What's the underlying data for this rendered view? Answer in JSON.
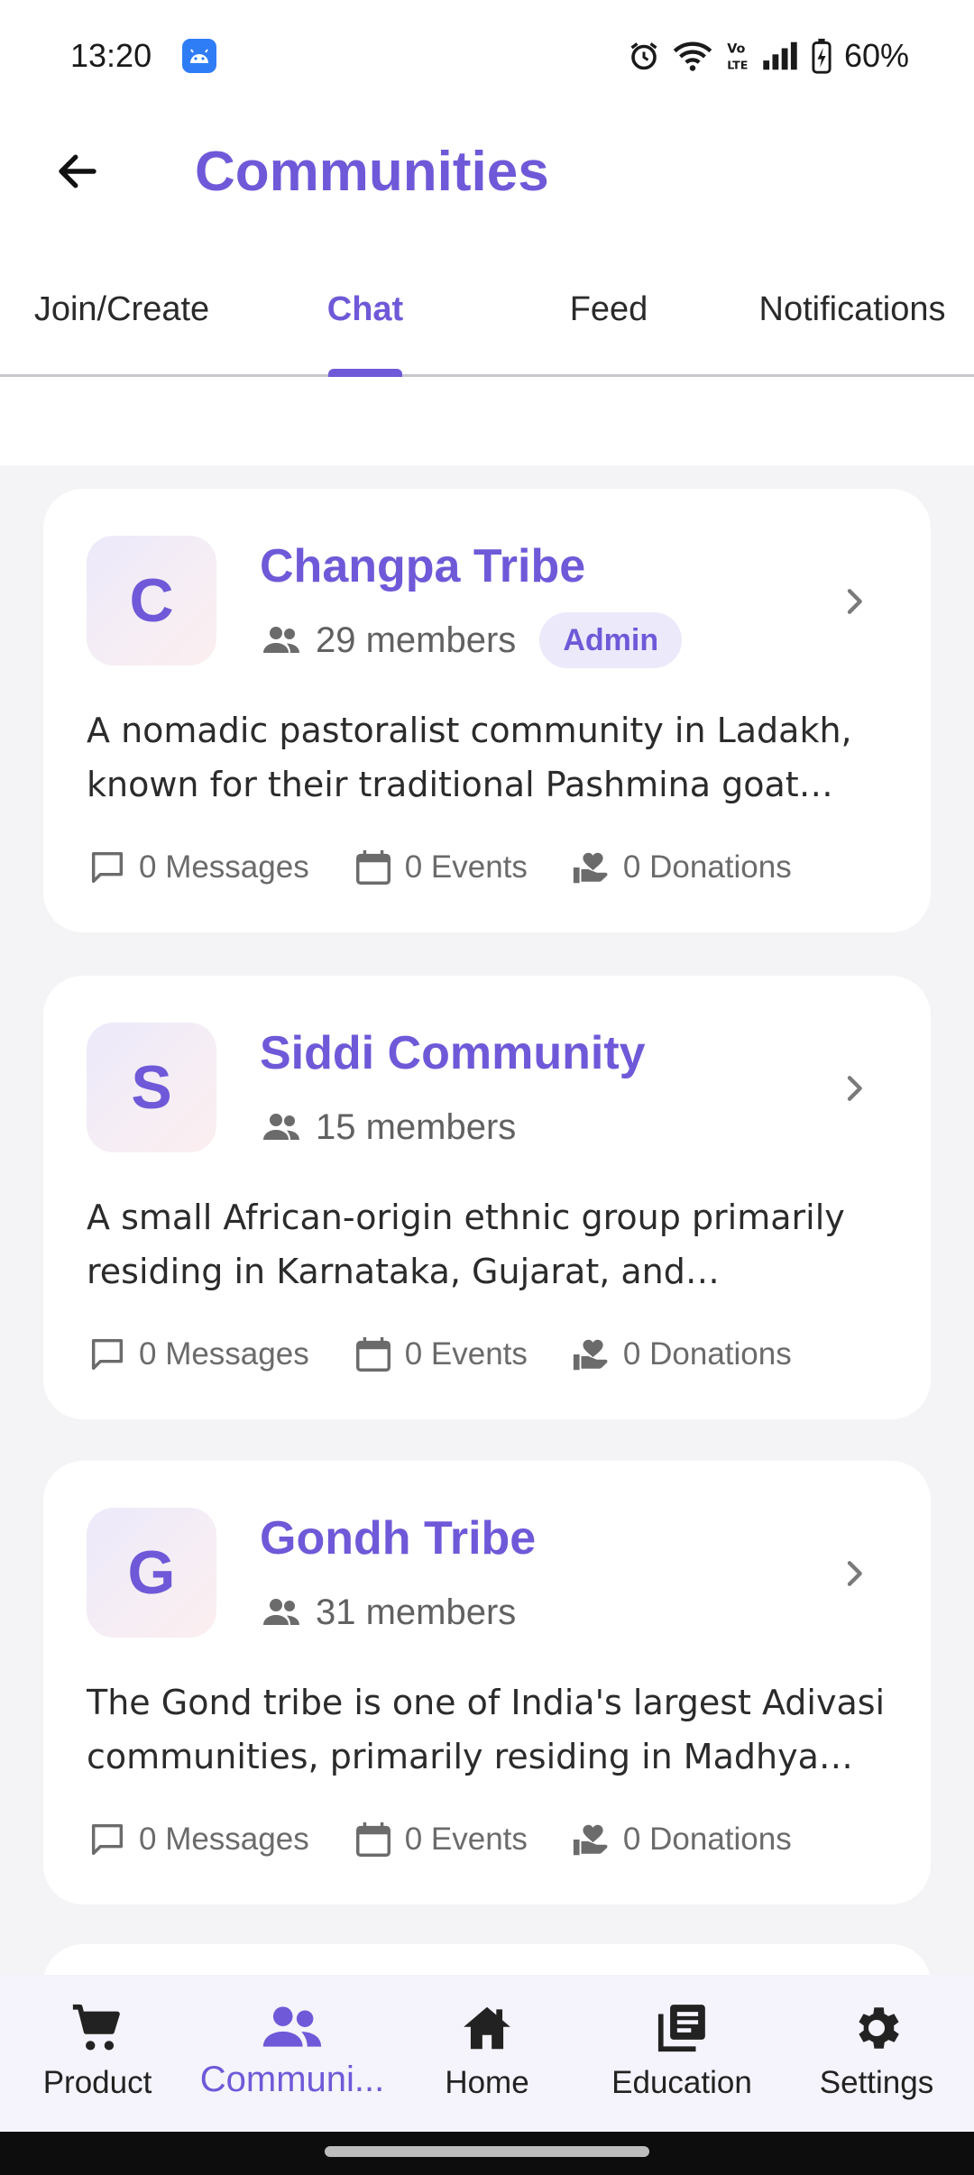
{
  "status_bar": {
    "time": "13:20",
    "battery": "60%",
    "icons": [
      "android-app-icon",
      "alarm-icon",
      "wifi-icon",
      "volte-icon",
      "signal-icon",
      "battery-charging-icon"
    ]
  },
  "header": {
    "title": "Communities",
    "back_icon": "arrow-left-icon"
  },
  "tabs": [
    {
      "label": "Join/Create",
      "active": false
    },
    {
      "label": "Chat",
      "active": true
    },
    {
      "label": "Feed",
      "active": false
    },
    {
      "label": "Notifications",
      "active": false
    }
  ],
  "communities": [
    {
      "initial": "C",
      "name": "Changpa Tribe",
      "members": "29 members",
      "role_badge": "Admin",
      "description": "A nomadic pastoralist community in Ladakh, known for their traditional Pashmina goat herding",
      "messages": "0 Messages",
      "events": "0 Events",
      "donations": "0 Donations"
    },
    {
      "initial": "S",
      "name": "Siddi Community",
      "members": "15 members",
      "description": "A small African-origin ethnic group primarily residing in Karnataka, Gujarat, and Maharashtra",
      "messages": "0 Messages",
      "events": "0 Events",
      "donations": "0 Donations"
    },
    {
      "initial": "G",
      "name": "Gondh Tribe",
      "members": "31 members",
      "description": "The Gond tribe is one of India's largest Adivasi communities, primarily residing in Madhya Pradesh",
      "messages": "0 Messages",
      "events": "0 Events",
      "donations": "0 Donations"
    }
  ],
  "bottom_nav": [
    {
      "label": "Product",
      "icon": "cart-icon",
      "active": false
    },
    {
      "label": "Communi...",
      "icon": "people-icon",
      "active": true
    },
    {
      "label": "Home",
      "icon": "home-icon",
      "active": false
    },
    {
      "label": "Education",
      "icon": "library-books-icon",
      "active": false
    },
    {
      "label": "Settings",
      "icon": "gear-icon",
      "active": false
    }
  ],
  "colors": {
    "accent": "#6f59d8",
    "badge_bg": "#ece9fb",
    "background": "#f4f4f6",
    "card": "#ffffff"
  }
}
